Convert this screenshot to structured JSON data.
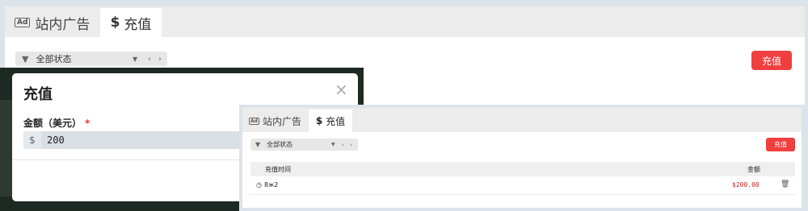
{
  "main": {
    "tabs": [
      {
        "label": "站内广告",
        "icon_text": "Ad"
      },
      {
        "label": "充值",
        "icon_text": "$"
      }
    ],
    "filter": {
      "value": "全部状态",
      "prev": "‹",
      "next": "›"
    },
    "recharge_button": "充值"
  },
  "modal": {
    "title": "充值",
    "close": "×",
    "field_label": "金额（美元）",
    "required_mark": "*",
    "currency_prefix": "$",
    "amount_value": "200"
  },
  "mini": {
    "tabs": [
      {
        "label": "站内广告",
        "icon_text": "Ad"
      },
      {
        "label": "充值",
        "icon_text": "$"
      }
    ],
    "filter": {
      "value": "全部状态",
      "prev": "‹",
      "next": "›"
    },
    "recharge_button": "充值",
    "table": {
      "headers": [
        "充值时间",
        "金额"
      ],
      "rows": [
        {
          "time": "8ж2",
          "amount": "$200.00"
        }
      ]
    }
  },
  "colors": {
    "accent_red": "#f03f3f",
    "amount_red": "#c62222"
  },
  "icons": [
    "ad-icon",
    "dollar-icon",
    "filter-icon",
    "chevron-down-icon",
    "chevron-left-icon",
    "chevron-right-icon",
    "close-icon",
    "clock-icon",
    "trash-icon"
  ]
}
